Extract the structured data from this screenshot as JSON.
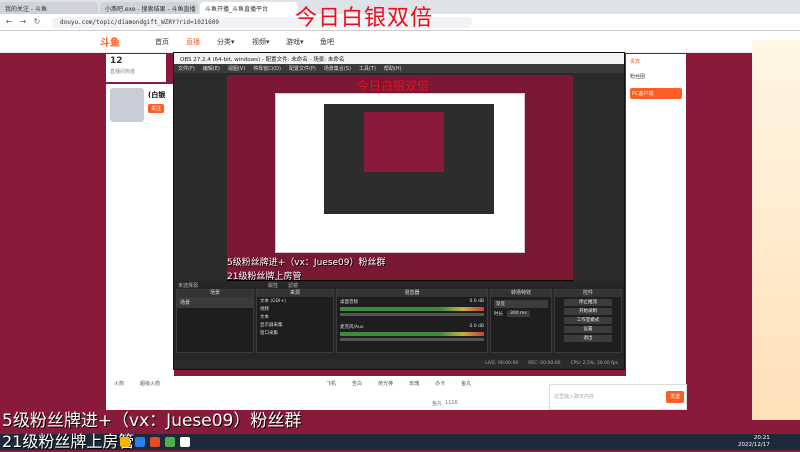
{
  "browser": {
    "tabs": [
      "我的关注 - 斗鱼",
      "小燕吧.exe - 搜索结果 - 斗鱼直播",
      "斗鱼开播_斗鱼直播平台"
    ],
    "url": "douyu.com/topic/diamondgift_WZRY?rid=1021609",
    "nav_back": "←",
    "nav_forward": "→",
    "nav_reload": "↻"
  },
  "overlay_title": "今日白银双倍",
  "douyu": {
    "logo": "斗鱼",
    "nav": [
      "首页",
      "直播",
      "分类▾",
      "视频▾",
      "游戏▾",
      "鱼吧"
    ],
    "room_count": "12",
    "room_label": "直播间热度",
    "streamer_name": "(白银",
    "follow_label": "关注"
  },
  "obs": {
    "title": "OBS 27.2.4 (64-bit, windows) - 配置文件: 未命名 - 场景: 未命名",
    "menu": [
      "文件(F)",
      "编辑(E)",
      "视图(V)",
      "停靠窗口(D)",
      "配置文件(P)",
      "场景集合(S)",
      "工具(T)",
      "帮助(H)"
    ],
    "preview_overlay_title": "今日白银双倍",
    "preview_caption_1": "5级粉丝牌进+（vx：Juese09）粉丝群",
    "preview_caption_2": "21级粉丝牌上房管",
    "no_source_selected": "未选择源",
    "properties_label": "属性",
    "filters_label": "滤镜",
    "scenes_header": "场景",
    "sources_header": "来源",
    "mixer_header": "混音器",
    "transitions_header": "转场特效",
    "controls_header": "控件",
    "scene_item": "场景",
    "sources": [
      "文本 (GDI+)",
      "视频",
      "文本",
      "显示器采集",
      "窗口采集"
    ],
    "mixer_tracks": [
      {
        "name": "桌面音频",
        "db": "0.0 dB"
      },
      {
        "name": "麦克风/Aux",
        "db": "0.0 dB"
      }
    ],
    "transition_value": "渐变",
    "duration_label": "时长",
    "duration_value": "300 ms",
    "controls": [
      "停止推流",
      "开始录制",
      "工作室模式",
      "设置",
      "退出"
    ],
    "status": {
      "live": "LIVE: 00:00:00",
      "rec": "REC: 00:00:00",
      "cpu": "CPU: 2.5%, 30.00 fps"
    }
  },
  "gift_bar": {
    "gifts": [
      "火箭",
      "超级火箭",
      "飞机",
      "告白",
      "荧光棒",
      "玫瑰",
      "办卡",
      "鱼丸"
    ],
    "fish_balls_label": "鱼丸",
    "fish_balls": "1116"
  },
  "chat": {
    "input_placeholder": "这里输入聊天内容",
    "send_label": "发送",
    "right_panel_items": [
      "贵宾",
      "粉丝团",
      "PC客户端"
    ]
  },
  "captions": {
    "line1": "5级粉丝牌进+（vx：Juese09）粉丝群",
    "line2": "21级粉丝牌上房管"
  },
  "taskbar": {
    "time": "20:21",
    "date": "2022/12/17"
  },
  "colors": {
    "douyu_orange": "#ff5d23",
    "caption_red": "#e8101e",
    "stream_background": "#8a1a3a"
  }
}
